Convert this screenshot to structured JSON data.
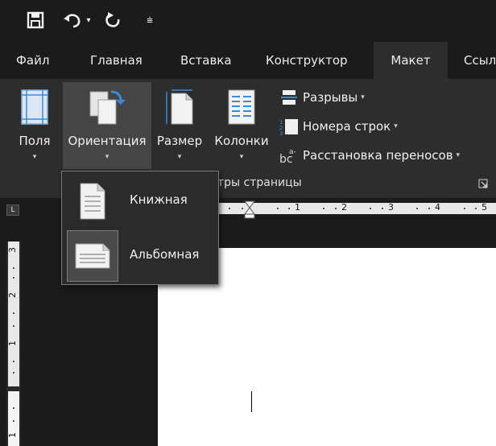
{
  "quick_access": {
    "save_icon": "save-icon",
    "undo_icon": "undo-icon",
    "undo_dropdown": "▾",
    "redo_icon": "redo-icon",
    "customize": "⩧"
  },
  "tabs": [
    {
      "label": "Файл"
    },
    {
      "label": "Главная"
    },
    {
      "label": "Вставка"
    },
    {
      "label": "Конструктор"
    },
    {
      "label": "Макет"
    },
    {
      "label": "Ссылки"
    }
  ],
  "ribbon": {
    "margins_label": "Поля",
    "orientation_label": "Ориентация",
    "size_label": "Размер",
    "columns_label": "Колонки",
    "breaks_label": "Разрывы",
    "line_numbers_label": "Номера строк",
    "hyphenation_label": "Расстановка переносов",
    "group_label_visible": "тры страницы",
    "caret": "▾"
  },
  "orientation_menu": {
    "items": [
      {
        "label": "Книжная",
        "icon": "portrait-page-icon",
        "selected": false
      },
      {
        "label": "Альбомная",
        "icon": "landscape-page-icon",
        "selected": true
      }
    ]
  },
  "ruler": {
    "corner": "L",
    "horizontal_numbers": [
      "1",
      "2",
      "3",
      "4",
      "5"
    ],
    "vertical_numbers": [
      "3",
      "2",
      "1",
      "1"
    ]
  },
  "colors": {
    "background": "#1b1b1b",
    "ribbon": "#2d2d2d",
    "menu": "#2b2b2b",
    "page": "#ffffff"
  }
}
